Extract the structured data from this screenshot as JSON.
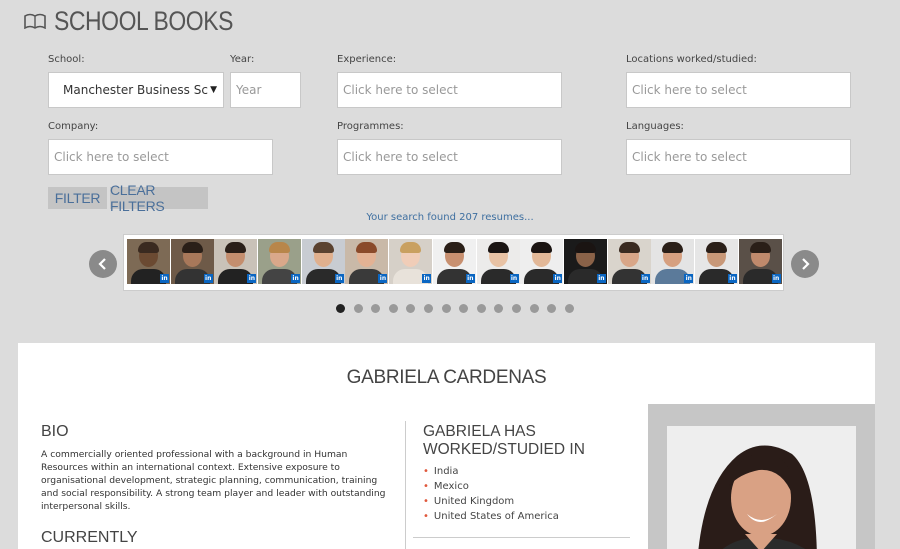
{
  "header": {
    "title": "SCHOOL BOOKS",
    "icon": "book-icon"
  },
  "filters": {
    "school": {
      "label": "School:",
      "value": "Manchester Business Sc"
    },
    "year": {
      "label": "Year:",
      "placeholder": "Year"
    },
    "experience": {
      "label": "Experience:",
      "placeholder": "Click here to select"
    },
    "locations": {
      "label": "Locations worked/studied:",
      "placeholder": "Click here to select"
    },
    "company": {
      "label": "Company:",
      "placeholder": "Click here to select"
    },
    "programmes": {
      "label": "Programmes:",
      "placeholder": "Click here to select"
    },
    "languages": {
      "label": "Languages:",
      "placeholder": "Click here to select"
    }
  },
  "buttons": {
    "filter": "FILTER",
    "clear": "CLEAR FILTERS"
  },
  "results": {
    "text": "Your search found 207 resumes..."
  },
  "carousel": {
    "thumbs": [
      {
        "li": "in"
      },
      {
        "li": "in"
      },
      {
        "li": "in"
      },
      {
        "li": "in"
      },
      {
        "li": "in"
      },
      {
        "li": "in"
      },
      {
        "li": "in"
      },
      {
        "li": "in"
      },
      {
        "li": "in"
      },
      {
        "li": "in"
      },
      {
        "li": "in"
      },
      {
        "li": "in"
      },
      {
        "li": "in"
      },
      {
        "li": "in"
      },
      {
        "li": "in"
      }
    ],
    "pages": 14,
    "active_page": 1
  },
  "profile": {
    "name": "GABRIELA CARDENAS",
    "bio_heading": "BIO",
    "bio": "A commercially oriented professional with a background in Human Resources within an international context. Extensive exposure to organisational development, strategic planning, communication, training and social responsibility. A strong team player and leader with outstanding interpersonal skills.",
    "currently_heading": "CURRENTLY",
    "worked_heading": "GABRIELA HAS WORKED/STUDIED IN",
    "locations": [
      "India",
      "Mexico",
      "United Kingdom",
      "United States of America"
    ]
  }
}
